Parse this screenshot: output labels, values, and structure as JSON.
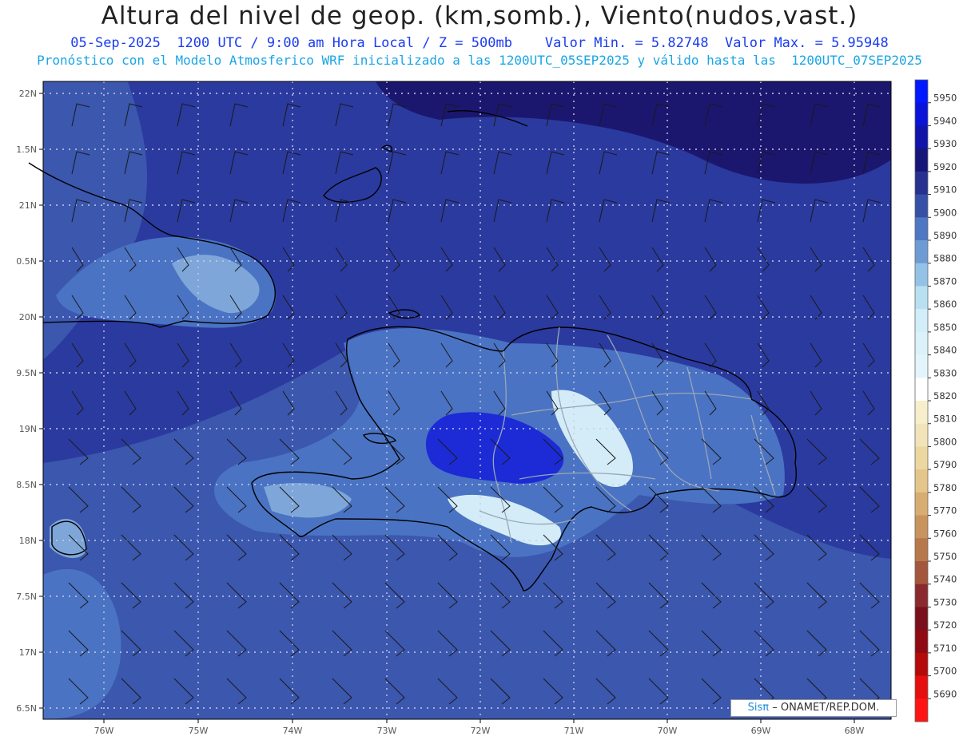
{
  "header": {
    "title": "Altura del nivel de geop. (km,somb.), Viento(nudos,vast.)",
    "subtitle_line1": "05-Sep-2025  1200 UTC / 9:00 am Hora Local / Z = 500mb    Valor Min. = 5.82748  Valor Max. = 5.95948",
    "subtitle_line2": "Pronóstico con el Modelo Atmosferico WRF inicializado a las 1200UTC_05SEP2025 y válido hasta las  1200UTC_07SEP2025"
  },
  "map": {
    "lat_labels": [
      "22N",
      "1.5N",
      "21N",
      "0.5N",
      "20N",
      "9.5N",
      "19N",
      "8.5N",
      "18N",
      "7.5N",
      "17N",
      "6.5N"
    ],
    "lon_labels": [
      "76W",
      "75W",
      "74W",
      "73W",
      "72W",
      "71W",
      "70W",
      "69W",
      "68W"
    ],
    "colors": {
      "ocean_main": "#2b3a9e",
      "ocean_south": "#3b57ae",
      "ocean_north": "#1b176e",
      "land_low": "#4a73c3",
      "land_mid": "#7ea6d8",
      "land_high": "#d4ecf7",
      "land_deep": "#1c2bd6",
      "coast": "#000000",
      "provinces": "#9aa6b8",
      "barbs": "#1a1a1a"
    }
  },
  "colorbar": {
    "labels": [
      "5950",
      "5940",
      "5930",
      "5920",
      "5910",
      "5900",
      "5890",
      "5880",
      "5870",
      "5860",
      "5850",
      "5840",
      "5830",
      "5820",
      "5810",
      "5800",
      "5790",
      "5780",
      "5770",
      "5760",
      "5750",
      "5740",
      "5730",
      "5720",
      "5710",
      "5700",
      "5690"
    ],
    "colors": [
      "#0019ff",
      "#0a14d8",
      "#1114a8",
      "#161578",
      "#27318f",
      "#3550a6",
      "#4f77c4",
      "#6f9bd4",
      "#93c2e6",
      "#b8e0f1",
      "#d2eef8",
      "#dcf2fa",
      "#e3f5fa",
      "#ffffff",
      "#f7efcc",
      "#f2e4b8",
      "#ecd7a0",
      "#e4c68a",
      "#d7ad72",
      "#c9935e",
      "#b7794c",
      "#a4573c",
      "#8a2a2e",
      "#7a101c",
      "#8f0a12",
      "#b40a0a",
      "#e60f0f",
      "#ff1414"
    ]
  },
  "credit": {
    "sis": "Sisπ",
    "text": "– ONAMET/REP.DOM."
  }
}
